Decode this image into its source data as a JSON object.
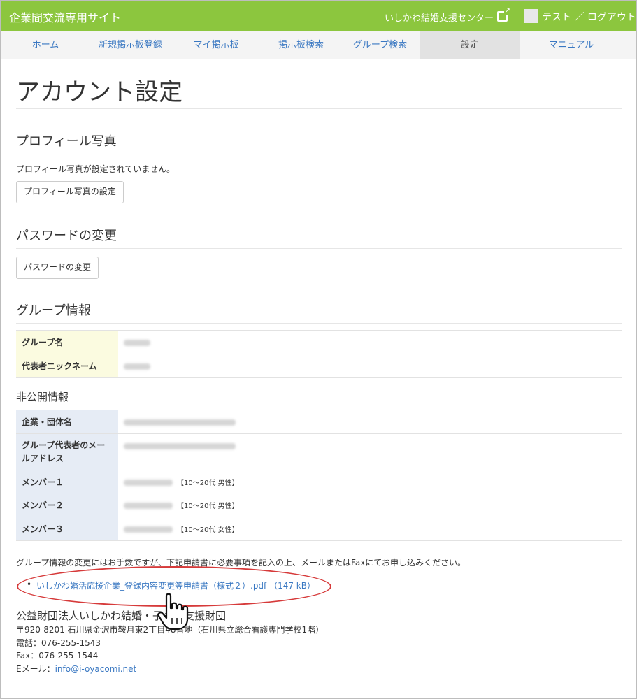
{
  "header": {
    "brand": "企業間交流専用サイト",
    "center_link": "いしかわ結婚支援センター",
    "user_link": "テスト ／ ログアウト",
    "accent_color": "#8cc63e"
  },
  "nav": {
    "items": [
      {
        "label": "ホーム"
      },
      {
        "label": "新規掲示板登録"
      },
      {
        "label": "マイ掲示板"
      },
      {
        "label": "掲示板検索"
      },
      {
        "label": "グループ検索"
      },
      {
        "label": "設定",
        "active": true
      },
      {
        "label": "マニュアル"
      }
    ]
  },
  "page": {
    "title": "アカウント設定",
    "profile": {
      "heading": "プロフィール写真",
      "status": "プロフィール写真が設定されていません。",
      "button": "プロフィール写真の設定"
    },
    "password": {
      "heading": "パスワードの変更",
      "button": "パスワードの変更"
    },
    "group": {
      "heading": "グループ情報",
      "rows": [
        {
          "label": "グループ名"
        },
        {
          "label": "代表者ニックネーム"
        }
      ]
    },
    "private": {
      "heading": "非公開情報",
      "rows": [
        {
          "label": "企業・団体名"
        },
        {
          "label": "グループ代表者のメールアドレス"
        },
        {
          "label": "メンバー１",
          "tag": "【10～20代 男性】"
        },
        {
          "label": "メンバー２",
          "tag": "【10～20代 男性】"
        },
        {
          "label": "メンバー３",
          "tag": "【10～20代 女性】"
        }
      ]
    },
    "notice": "グループ情報の変更にはお手数ですが、下記申請書に必要事項を記入の上、メールまたはFaxにてお申し込みください。",
    "document": {
      "bullet": "•",
      "link": "いしかわ婚活応援企業_登録内容変更等申請書（様式２）.pdf （147 kB）"
    },
    "org": {
      "name": "公益財団法人いしかわ結婚・子育て支援財団",
      "address": "〒920-8201 石川県金沢市鞍月東2丁目48番地（石川県立総合看護専門学校1階）",
      "tel": "電話：076-255-1543",
      "fax": "Fax：076-255-1544",
      "email_label": "Eメール：",
      "email": "info@i-oyacomi.net"
    }
  }
}
